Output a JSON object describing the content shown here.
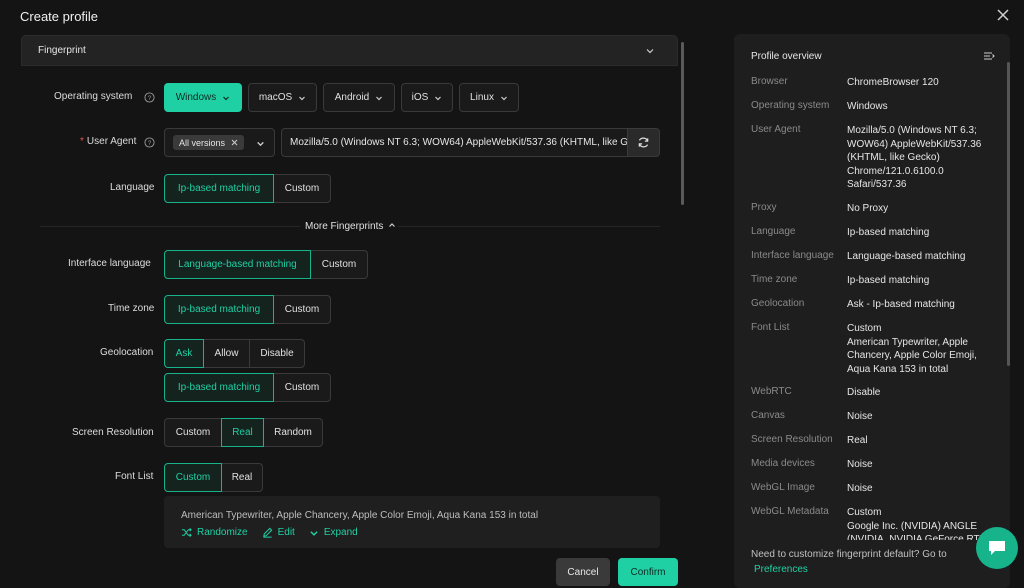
{
  "window": {
    "title": "Create profile"
  },
  "section": {
    "title": "Fingerprint"
  },
  "os": {
    "label": "Operating system",
    "options": [
      {
        "label": "Windows",
        "selected": true
      },
      {
        "label": "macOS",
        "selected": false
      },
      {
        "label": "Android",
        "selected": false
      },
      {
        "label": "iOS",
        "selected": false
      },
      {
        "label": "Linux",
        "selected": false
      }
    ]
  },
  "user_agent": {
    "label": "User Agent",
    "required_mark": "*",
    "version_tag": "All versions",
    "value": "Mozilla/5.0 (Windows NT 6.3; WOW64) AppleWebKit/537.36 (KHTML, like Gecko) Chrome/121.0.6100.0 Safari/537.36"
  },
  "language": {
    "label": "Language",
    "options": [
      "Ip-based matching",
      "Custom"
    ],
    "selected": 0
  },
  "more_fingerprints": "More Fingerprints",
  "interface_language": {
    "label": "Interface language",
    "options": [
      "Language-based matching",
      "Custom"
    ],
    "selected": 0
  },
  "time_zone": {
    "label": "Time zone",
    "options": [
      "Ip-based matching",
      "Custom"
    ],
    "selected": 0
  },
  "geolocation": {
    "label": "Geolocation",
    "options": [
      "Ask",
      "Allow",
      "Disable"
    ],
    "selected": 0,
    "sub_options": [
      "Ip-based matching",
      "Custom"
    ],
    "sub_selected": 0
  },
  "screen_resolution": {
    "label": "Screen Resolution",
    "options": [
      "Custom",
      "Real",
      "Random"
    ],
    "selected": 1
  },
  "font_list": {
    "label": "Font List",
    "options": [
      "Custom",
      "Real"
    ],
    "selected": 0,
    "text": "American Typewriter, Apple Chancery, Apple Color Emoji, Aqua Kana 153 in total",
    "actions": {
      "randomize": "Randomize",
      "edit": "Edit",
      "expand": "Expand"
    }
  },
  "footer": {
    "cancel": "Cancel",
    "confirm": "Confirm"
  },
  "overview": {
    "title": "Profile overview",
    "rows": [
      {
        "label": "Browser",
        "value": "ChromeBrowser 120"
      },
      {
        "label": "Operating system",
        "value": "Windows"
      },
      {
        "label": "User Agent",
        "value": "Mozilla/5.0 (Windows NT 6.3; WOW64) AppleWebKit/537.36 (KHTML, like Gecko) Chrome/121.0.6100.0 Safari/537.36"
      },
      {
        "label": "Proxy",
        "value": "No Proxy"
      },
      {
        "label": "Language",
        "value": "Ip-based matching"
      },
      {
        "label": "Interface language",
        "value": "Language-based matching"
      },
      {
        "label": "Time zone",
        "value": "Ip-based matching"
      },
      {
        "label": "Geolocation",
        "value": "Ask - Ip-based matching"
      },
      {
        "label": "Font List",
        "value": "Custom\nAmerican Typewriter, Apple Chancery, Apple Color Emoji, Aqua Kana 153 in total"
      },
      {
        "label": "WebRTC",
        "value": "Disable"
      },
      {
        "label": "Canvas",
        "value": "Noise"
      },
      {
        "label": "Screen Resolution",
        "value": "Real"
      },
      {
        "label": "Media devices",
        "value": "Noise"
      },
      {
        "label": "WebGL Image",
        "value": "Noise"
      },
      {
        "label": "WebGL Metadata",
        "value": "Custom\nGoogle Inc. (NVIDIA) ANGLE (NVIDIA, NVIDIA GeForce RTX"
      }
    ],
    "footer_text": "Need to customize fingerprint default? Go to",
    "footer_link": "Preferences"
  },
  "colors": {
    "accent": "#1fd0a4",
    "background": "#141414",
    "panel": "#1e1e1e"
  }
}
